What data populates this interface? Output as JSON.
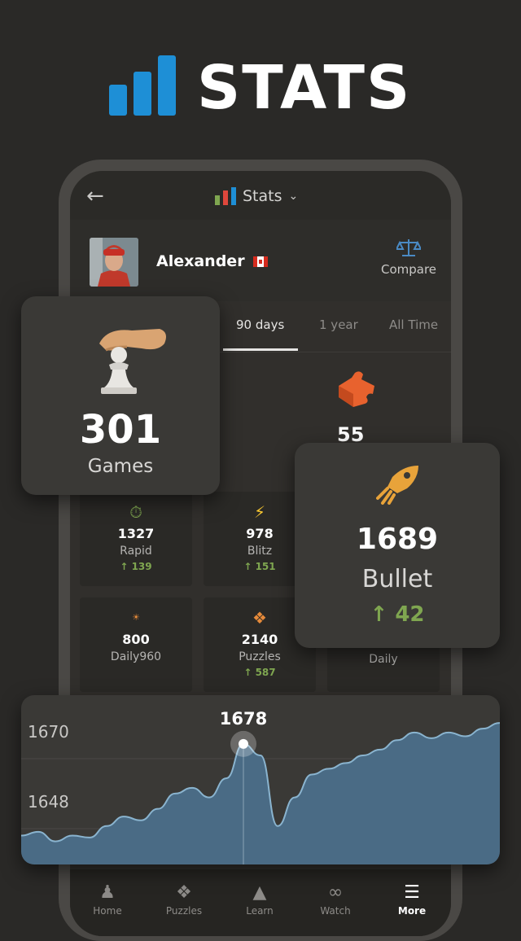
{
  "hero": {
    "title": "STATS"
  },
  "app": {
    "title": "Stats",
    "back_icon": "arrow-left-icon",
    "dropdown_icon": "chevron-down-icon"
  },
  "profile": {
    "name": "Alexander",
    "country": "Canada",
    "compare_label": "Compare"
  },
  "tabs": [
    {
      "label": "90 days",
      "active": true
    },
    {
      "label": "1 year",
      "active": false
    },
    {
      "label": "All Time",
      "active": false
    }
  ],
  "puzzles_summary": {
    "value": "55"
  },
  "games_card": {
    "value": "301",
    "label": "Games"
  },
  "bullet_card": {
    "value": "1689",
    "label": "Bullet",
    "change": "42",
    "arrow": "↑"
  },
  "ratings": [
    {
      "label": "Rapid",
      "value": "1327",
      "change": "139",
      "icon": "stopwatch-icon",
      "color": "#7fa650"
    },
    {
      "label": "Blitz",
      "value": "978",
      "change": "151",
      "icon": "lightning-icon",
      "color": "#f7c631"
    },
    {
      "label": "Daily960",
      "value": "800",
      "change": "",
      "icon": "daily960-icon",
      "color": "#e58a3a"
    },
    {
      "label": "Puzzles",
      "value": "2140",
      "change": "587",
      "icon": "puzzle-icon",
      "color": "#e58a3a"
    },
    {
      "label": "Daily",
      "value": "",
      "change": "",
      "icon": "sun-icon",
      "color": "#f7c631"
    }
  ],
  "chart_data": {
    "type": "area",
    "y_ticks": [
      "1670",
      "1648"
    ],
    "hover_value": "1678",
    "series_color": "#4a6b85",
    "line_color": "#8ab4cf",
    "values": [
      1630,
      1632,
      1627,
      1630,
      1629,
      1635,
      1640,
      1638,
      1644,
      1652,
      1655,
      1650,
      1660,
      1678,
      1672,
      1635,
      1650,
      1662,
      1665,
      1668,
      1672,
      1675,
      1680,
      1684,
      1681,
      1684,
      1682,
      1686,
      1689
    ],
    "ylim": [
      1620,
      1695
    ],
    "grid": true
  },
  "nav": [
    {
      "label": "Home",
      "icon": "pawn-icon",
      "active": false
    },
    {
      "label": "Puzzles",
      "icon": "puzzle-icon",
      "active": false
    },
    {
      "label": "Learn",
      "icon": "graduation-cap-icon",
      "active": false
    },
    {
      "label": "Watch",
      "icon": "binoculars-icon",
      "active": false
    },
    {
      "label": "More",
      "icon": "menu-icon",
      "active": true
    }
  ]
}
